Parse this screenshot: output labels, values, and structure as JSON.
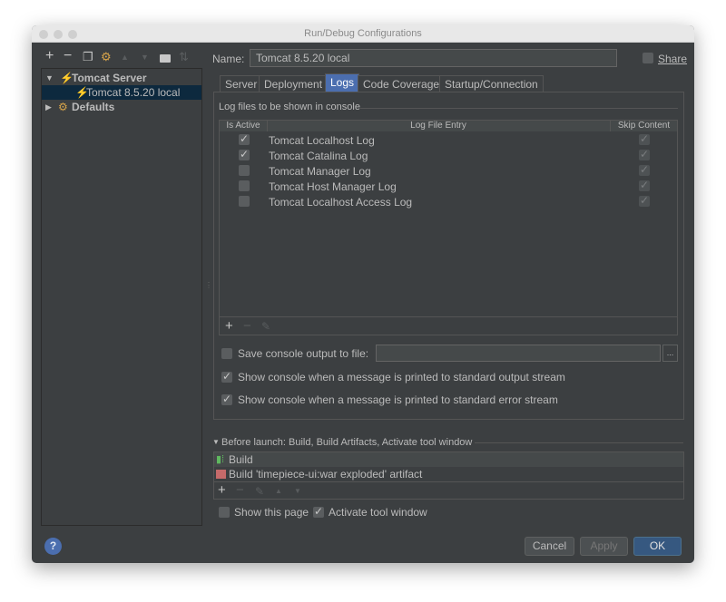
{
  "window": {
    "title": "Run/Debug Configurations"
  },
  "toolbar": {
    "icons": [
      "plus-icon",
      "minus-icon",
      "copy-icon",
      "wrench-icon",
      "arrow-up-icon",
      "arrow-down-icon",
      "folder-icon",
      "sort-icon"
    ]
  },
  "tree": {
    "items": [
      {
        "label": "Tomcat Server",
        "expanded": true
      },
      {
        "label": "Tomcat 8.5.20 local",
        "selected": true
      },
      {
        "label": "Defaults",
        "expanded": false
      }
    ]
  },
  "name": {
    "label": "Name:",
    "value": "Tomcat 8.5.20 local"
  },
  "share": {
    "label": "Share",
    "checked": false
  },
  "tabs": [
    {
      "label": "Server"
    },
    {
      "label": "Deployment"
    },
    {
      "label": "Logs",
      "active": true
    },
    {
      "label": "Code Coverage"
    },
    {
      "label": "Startup/Connection"
    }
  ],
  "logs": {
    "section_title": "Log files to be shown in console",
    "columns": [
      "Is Active",
      "Log File Entry",
      "Skip Content"
    ],
    "rows": [
      {
        "active": true,
        "entry": "Tomcat Localhost Log",
        "skip": true
      },
      {
        "active": true,
        "entry": "Tomcat Catalina Log",
        "skip": true
      },
      {
        "active": false,
        "entry": "Tomcat Manager Log",
        "skip": true
      },
      {
        "active": false,
        "entry": "Tomcat Host Manager Log",
        "skip": true
      },
      {
        "active": false,
        "entry": "Tomcat Localhost Access Log",
        "skip": true
      }
    ],
    "save_label": "Save console output to file:",
    "save_checked": false,
    "save_value": "",
    "browse_label": "...",
    "stdout_label": "Show console when a message is printed to standard output stream",
    "stdout_checked": true,
    "stderr_label": "Show console when a message is printed to standard error stream",
    "stderr_checked": true
  },
  "before_launch": {
    "title": "Before launch: Build, Build Artifacts, Activate tool window",
    "items": [
      "Build",
      "Build 'timepiece-ui:war exploded' artifact"
    ]
  },
  "bottom": {
    "show_page": "Show this page",
    "show_page_checked": false,
    "activate": "Activate tool window",
    "activate_checked": true
  },
  "buttons": {
    "help": "?",
    "cancel": "Cancel",
    "apply": "Apply",
    "ok": "OK"
  },
  "colors": {
    "accent": "#4b6eaf",
    "background": "#3c3f41",
    "selection": "#0d293e"
  }
}
